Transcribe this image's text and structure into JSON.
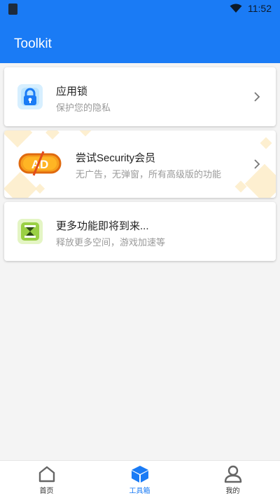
{
  "status_bar": {
    "time": "11:52"
  },
  "app_bar": {
    "title": "Toolkit"
  },
  "cards": [
    {
      "title": "应用锁",
      "subtitle": "保护您的隐私",
      "icon": "lock-icon"
    },
    {
      "title": "尝试Security会员",
      "subtitle": "无广告，无弹窗，所有高级版的功能",
      "icon": "ad-free-icon",
      "badge_text": "AD"
    },
    {
      "title": "更多功能即将到来...",
      "subtitle": "释放更多空间，游戏加速等",
      "icon": "hourglass-icon"
    }
  ],
  "bottom_nav": {
    "items": [
      {
        "label": "首页",
        "icon": "home-icon",
        "active": false
      },
      {
        "label": "工具箱",
        "icon": "toolbox-cube-icon",
        "active": true
      },
      {
        "label": "我的",
        "icon": "profile-icon",
        "active": false
      }
    ]
  },
  "colors": {
    "primary": "#1a7bf5",
    "background": "#f4f4f4"
  }
}
